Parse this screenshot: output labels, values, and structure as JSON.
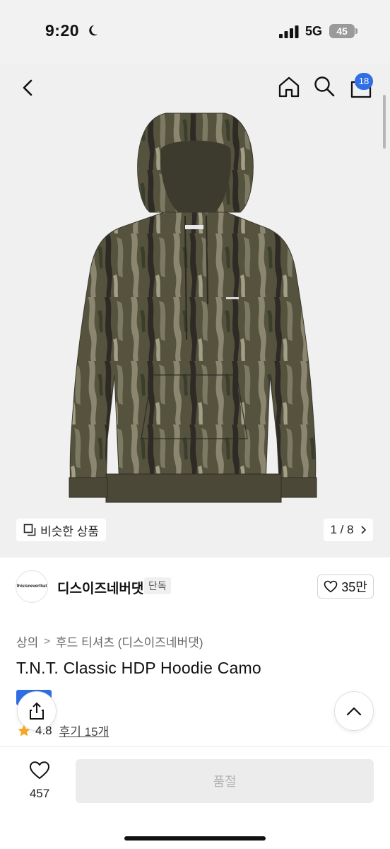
{
  "status_bar": {
    "time": "9:20",
    "network": "5G",
    "battery": "45"
  },
  "top_nav": {
    "cart_count": "18"
  },
  "gallery": {
    "similar_label": "비슷한 상품",
    "pager": "1 / 8"
  },
  "brand": {
    "name": "디스이즈네버댓",
    "tag": "단독",
    "logo_text": "thisisneverthat",
    "likes": "35만"
  },
  "breadcrumb": {
    "level1": "상의",
    "level2": "후드 티셔츠 (디스이즈네버댓)"
  },
  "product": {
    "title": "T.N.T. Classic HDP Hoodie Camo"
  },
  "rating": {
    "score": "4.8",
    "reviews": "후기 15개"
  },
  "bottom": {
    "wish_count": "457",
    "action_label": "품절"
  },
  "colors": {
    "accent": "#2f6ee5",
    "star": "#f5a623",
    "camo_base": "#4a4a3a"
  }
}
